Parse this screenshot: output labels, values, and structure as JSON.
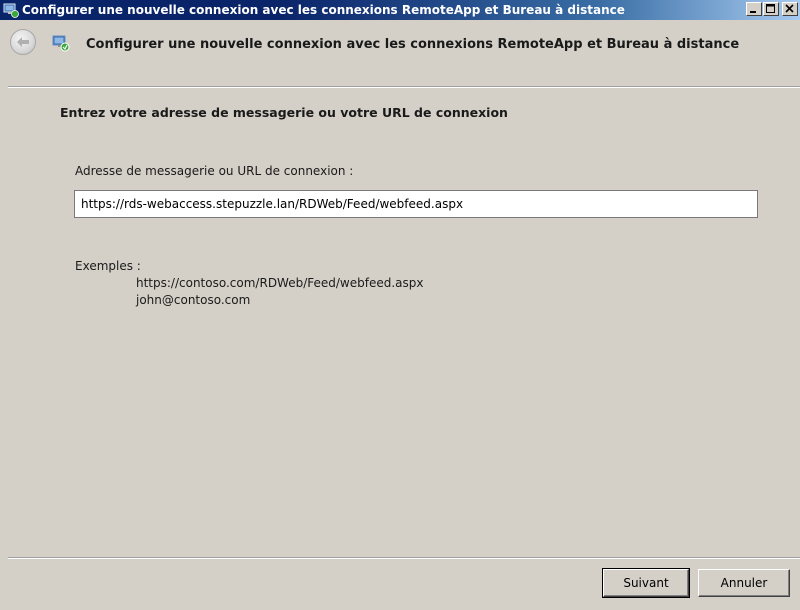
{
  "window": {
    "title": "Configurer une nouvelle connexion avec les connexions RemoteApp et Bureau à distance",
    "controls": {
      "minimize": "_",
      "maximize": "□",
      "close": "×"
    }
  },
  "nav": {
    "title": "Configurer une nouvelle connexion avec les connexions RemoteApp et Bureau à distance"
  },
  "main": {
    "heading": "Entrez votre adresse de messagerie ou votre URL de connexion",
    "field_label": "Adresse de messagerie ou URL de connexion :",
    "url_value": "https://rds-webaccess.stepuzzle.lan/RDWeb/Feed/webfeed.aspx",
    "examples_label": "Exemples :",
    "examples": [
      "https://contoso.com/RDWeb/Feed/webfeed.aspx",
      "john@contoso.com"
    ]
  },
  "footer": {
    "next_label": "Suivant",
    "cancel_label": "Annuler"
  },
  "icons": {
    "app": "remoteapp-connection-icon",
    "back": "back-arrow-icon"
  }
}
